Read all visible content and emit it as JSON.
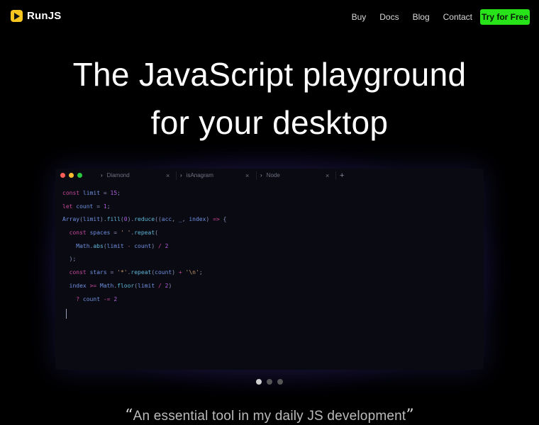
{
  "brand": {
    "name": "RunJS"
  },
  "nav": {
    "links": [
      "Buy",
      "Docs",
      "Blog",
      "Contact"
    ],
    "cta": "Try for Free"
  },
  "hero": {
    "line1": "The JavaScript playground",
    "line2": "for your desktop"
  },
  "editor": {
    "tabs": [
      {
        "label": "Diamond"
      },
      {
        "label": "isAnagram"
      },
      {
        "label": "Node"
      }
    ],
    "close_glyph": "×",
    "add_tab_glyph": "+",
    "code": {
      "l1": {
        "kw": "const",
        "var": "limit",
        "op": "=",
        "num": "15",
        "end": ";"
      },
      "l2": {
        "kw": "let",
        "var": "count",
        "op": "=",
        "num": "1",
        "end": ";"
      },
      "l3": {
        "a": "Array",
        "b": "limit",
        "c": "fill",
        "d": "0",
        "e": "reduce",
        "f": "acc",
        "g": "_",
        "h": "index",
        "i": "=>",
        "j": "{"
      },
      "l4": {
        "kw": "const",
        "var": "spaces",
        "op": "=",
        "str": "' '",
        "fn": "repeat",
        "end": "("
      },
      "l5": {
        "a": "Math",
        "b": "abs",
        "c": "limit",
        "d": "-",
        "e": "count",
        "f": "/",
        "g": "2"
      },
      "l6": {
        "text": ");"
      },
      "l7": {
        "kw": "const",
        "var": "stars",
        "op": "=",
        "str": "'*'",
        "fn": "repeat",
        "c": "count",
        "plus": "+",
        "nl": "'\\n'",
        "end": ";"
      },
      "l8": {
        "a": "index",
        "b": ">=",
        "c": "Math",
        "d": "floor",
        "e": "limit",
        "f": "/",
        "g": "2"
      },
      "l9": {
        "a": "?",
        "b": "count",
        "c": "-=",
        "d": "2"
      }
    }
  },
  "carousel": {
    "count": 3,
    "active": 0
  },
  "quote": {
    "open": "“",
    "text": "An essential tool in my daily JS development",
    "close": "”"
  },
  "colors": {
    "accent": "#28e21a",
    "logo": "#f7c520",
    "background": "#000000",
    "editor_bg": "#0a0b12"
  }
}
